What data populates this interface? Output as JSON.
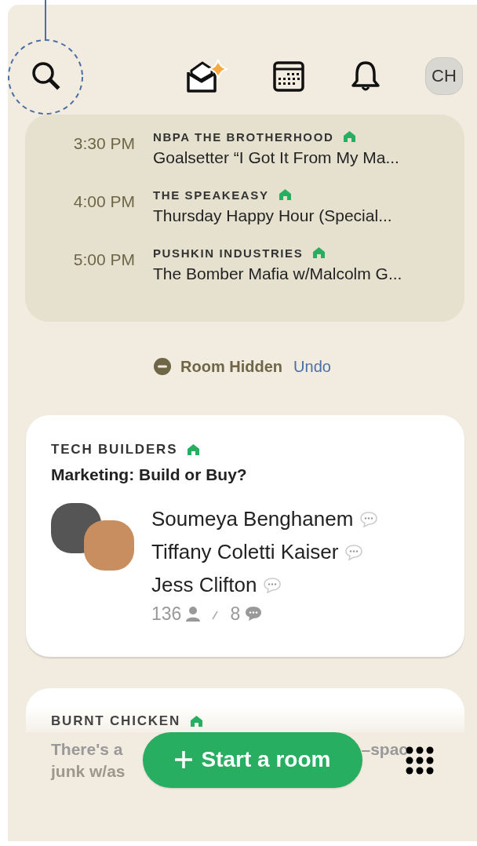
{
  "header": {
    "avatar_initials": "CH"
  },
  "upcoming": [
    {
      "time": "3:30 PM",
      "club": "NBPA THE BROTHERHOOD",
      "title": "Goalsetter “I Got It From My Ma..."
    },
    {
      "time": "4:00 PM",
      "club": "THE SPEAKEASY",
      "title": "Thursday Happy Hour (Special..."
    },
    {
      "time": "5:00 PM",
      "club": "PUSHKIN INDUSTRIES",
      "title": "The Bomber Mafia w/Malcolm G..."
    }
  ],
  "hidden_notice": {
    "label": "Room Hidden",
    "action": "Undo"
  },
  "room": {
    "club": "TECH BUILDERS",
    "title": "Marketing: Build or Buy?",
    "speakers": [
      {
        "name": "Soumeya Benghanem"
      },
      {
        "name": "Tiffany Coletti Kaiser"
      },
      {
        "name": "Jess Clifton"
      }
    ],
    "listeners": "136",
    "speakers_count": "8"
  },
  "partial_room": {
    "club": "BURNT CHICKEN",
    "title_start": "There's a",
    "title_end": "–spac",
    "second_line": "junk w/as"
  },
  "fab": {
    "label": "Start a room"
  }
}
